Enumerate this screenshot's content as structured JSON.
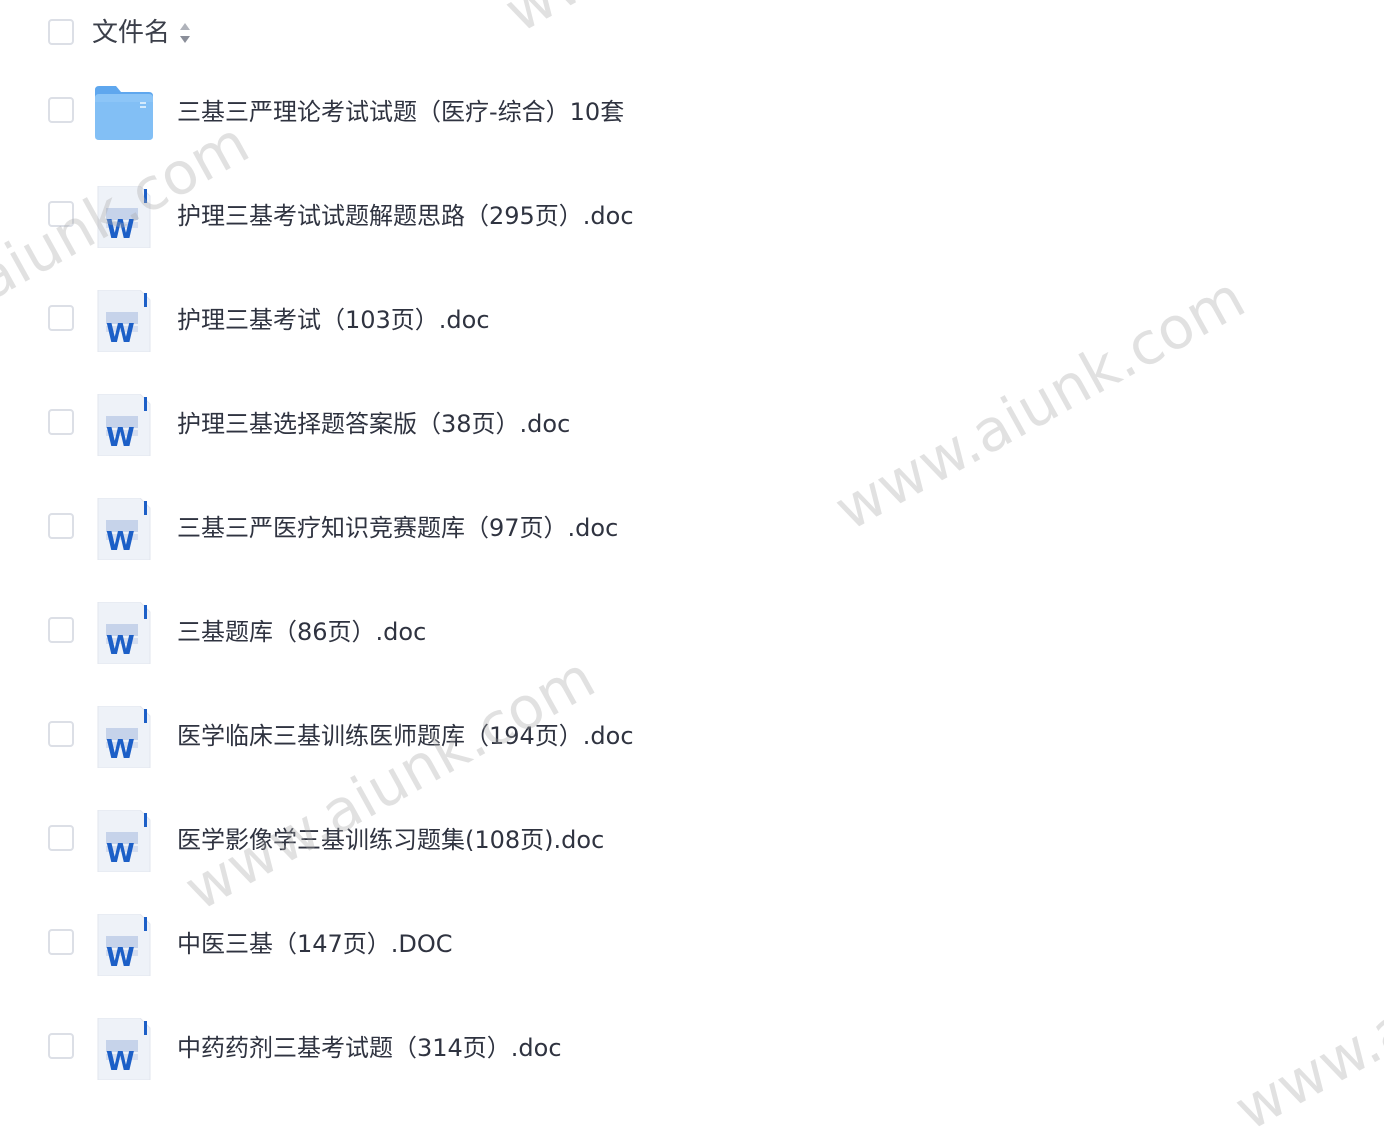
{
  "header": {
    "column_label": "文件名",
    "sort_icon": "sort-caret-icon"
  },
  "files": [
    {
      "name": "三基三严理论考试试题（医疗-综合）10套",
      "type": "folder",
      "icon": "folder-icon"
    },
    {
      "name": "护理三基考试试题解题思路（295页）.doc",
      "type": "doc",
      "icon": "word-doc-icon"
    },
    {
      "name": "护理三基考试（103页）.doc",
      "type": "doc",
      "icon": "word-doc-icon"
    },
    {
      "name": "护理三基选择题答案版（38页）.doc",
      "type": "doc",
      "icon": "word-doc-icon"
    },
    {
      "name": "三基三严医疗知识竞赛题库（97页）.doc",
      "type": "doc",
      "icon": "word-doc-icon"
    },
    {
      "name": "三基题库（86页）.doc",
      "type": "doc",
      "icon": "word-doc-icon"
    },
    {
      "name": "医学临床三基训练医师题库（194页）.doc",
      "type": "doc",
      "icon": "word-doc-icon"
    },
    {
      "name": "医学影像学三基训练习题集(108页).doc",
      "type": "doc",
      "icon": "word-doc-icon"
    },
    {
      "name": "中医三基（147页）.DOC",
      "type": "doc",
      "icon": "word-doc-icon"
    },
    {
      "name": "中药药剂三基考试题（314页）.doc",
      "type": "doc",
      "icon": "word-doc-icon"
    }
  ],
  "watermark_text": "www.aiunk.com",
  "colors": {
    "folder": "#7db8f2",
    "word_blue": "#1c5fc7",
    "checkbox_border": "#dcdfe6",
    "text": "#2f3340"
  }
}
